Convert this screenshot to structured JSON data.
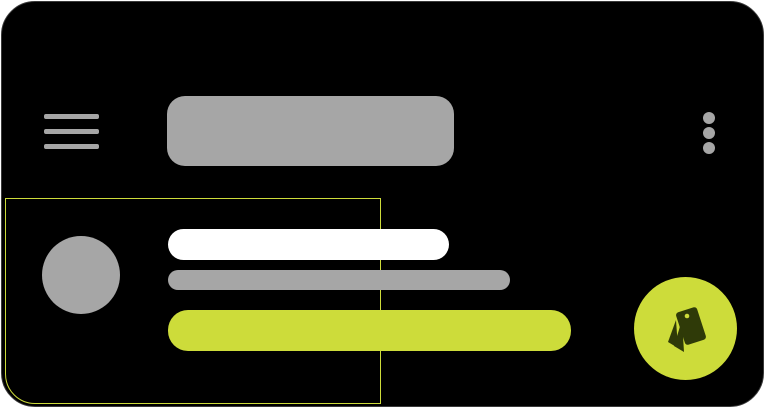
{
  "colors": {
    "background": "#000000",
    "placeholder": "#a6a6a6",
    "accent": "#cddc3a",
    "primary_line": "#ffffff",
    "fab_icon": "#2f3a08"
  },
  "top_bar": {
    "menu_icon": "hamburger-menu-icon",
    "title": "",
    "more_icon": "vertical-dots-icon"
  },
  "list_item": {
    "selected": true,
    "avatar": "avatar-placeholder"
  },
  "fab": {
    "icon": "card-stack-icon"
  }
}
